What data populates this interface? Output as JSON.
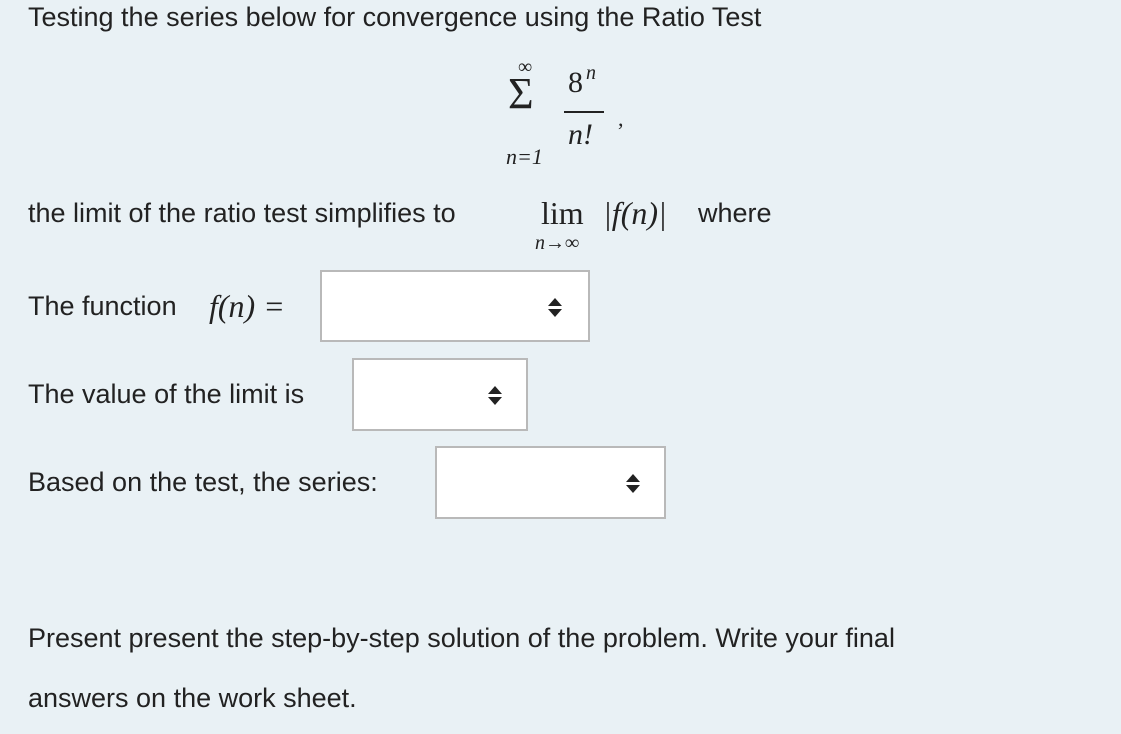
{
  "question": {
    "intro": "Testing the series below for convergence using the Ratio Test",
    "series": {
      "sigma": "Σ",
      "upper_limit": "∞",
      "lower_limit": "n=1",
      "numerator_base": "8",
      "numerator_exponent": "n",
      "denominator": "n!",
      "trailing_punct": ","
    },
    "limit_sentence_prefix": "the limit of the ratio test simplifies to",
    "limit_op": "lim",
    "limit_sub": "n→∞",
    "limit_expr": "|f(n)|",
    "limit_sentence_suffix": "where",
    "function_label": "The function",
    "function_math": "f(n) =",
    "limit_value_label": "The value of the limit is",
    "series_result_label": "Based on the test, the series:",
    "instructions_line1": "Present present the step-by-step solution of the problem. Write your final",
    "instructions_line2": "answers on the work sheet."
  },
  "dropdowns": {
    "function_value": "",
    "limit_value": "",
    "series_result": ""
  },
  "icons": {
    "select_arrows": "updown-caret-icon"
  }
}
